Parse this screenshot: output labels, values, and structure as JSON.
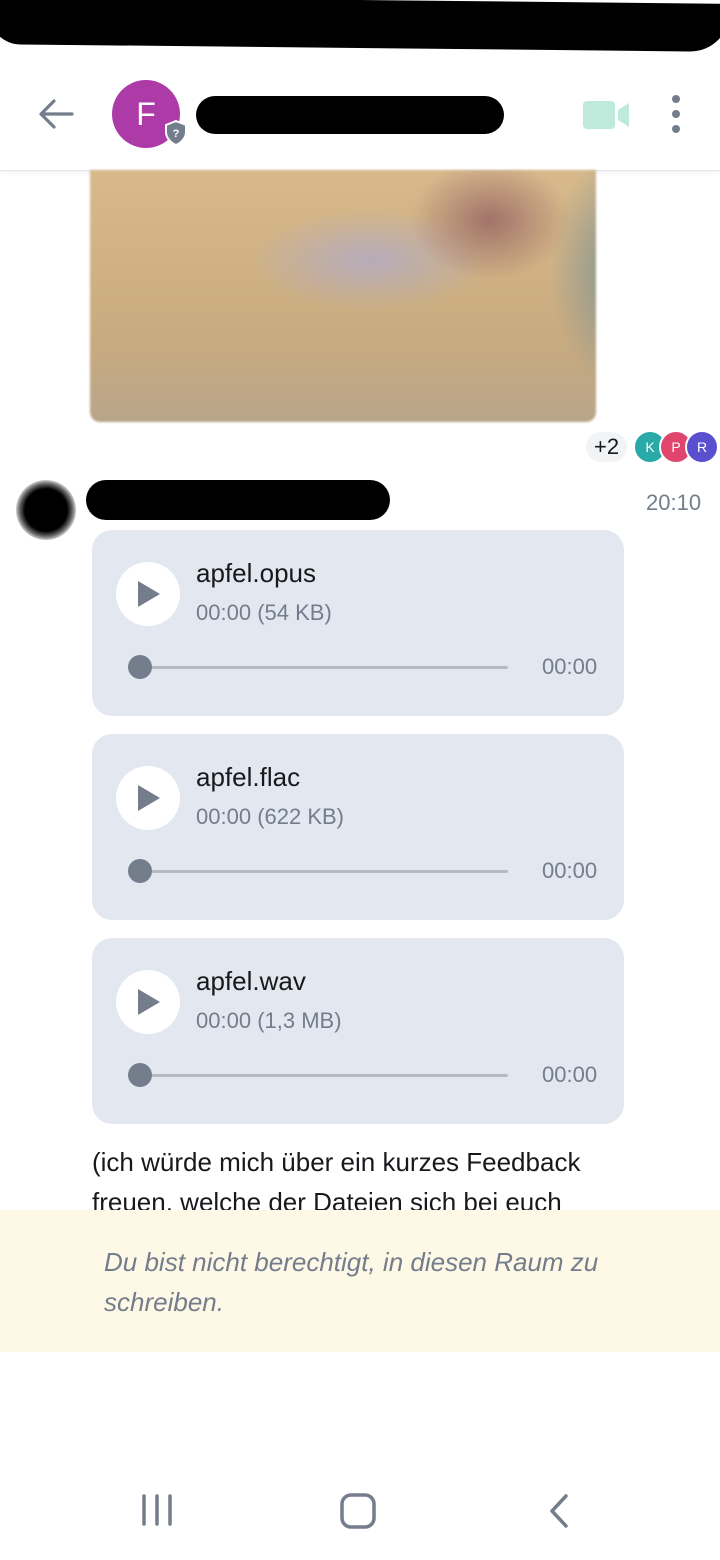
{
  "header": {
    "avatar_letter": "F",
    "colors": {
      "avatar": "#ac3ba8",
      "video_icon": "#0dbd8b"
    }
  },
  "icons": [
    "arrow-left-icon",
    "shield-question-icon",
    "video-camera-icon",
    "more-vertical-icon",
    "play-icon",
    "recent-apps-icon",
    "home-icon",
    "back-chevron-icon"
  ],
  "receipts": {
    "count": "+2",
    "avatars": [
      {
        "letter": "K",
        "color": "#2aa9a9"
      },
      {
        "letter": "P",
        "color": "#e0466d"
      },
      {
        "letter": "R",
        "color": "#5a4fcf"
      }
    ]
  },
  "message": {
    "time": "20:10",
    "attachments": [
      {
        "name": "apfel.opus",
        "position": "00:00",
        "size": "(54 KB)",
        "duration": "00:00",
        "progress": 0
      },
      {
        "name": "apfel.flac",
        "position": "00:00",
        "size": "(622 KB)",
        "duration": "00:00",
        "progress": 0
      },
      {
        "name": "apfel.wav",
        "position": "00:00",
        "size": "(1,3 MB)",
        "duration": "00:00",
        "progress": 0
      }
    ],
    "text": "(ich würde mich über ein kurzes Feedback freuen, welche der Dateien sich bei euch"
  },
  "composer": {
    "no_permission_text": "Du bist nicht berechtigt, in diesen Raum zu schreiben."
  }
}
